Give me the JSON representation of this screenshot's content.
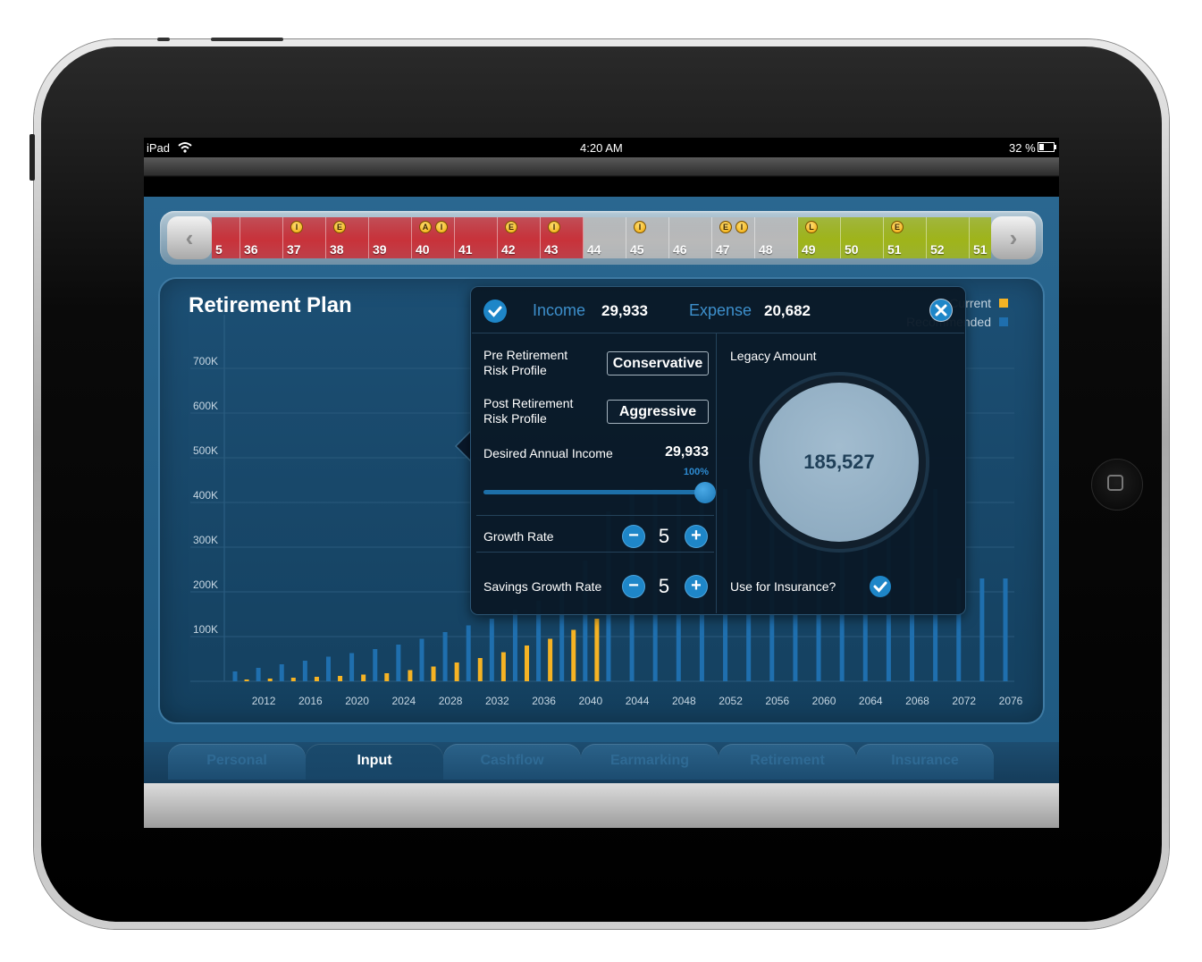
{
  "status_bar": {
    "device": "iPad",
    "time": "4:20 AM",
    "battery": "32 %"
  },
  "timeline": {
    "prev_icon": "chevron-left-icon",
    "next_icon": "chevron-right-icon",
    "cells": [
      {
        "age": "5",
        "color": "#c8323a",
        "badges": []
      },
      {
        "age": "36",
        "color": "#c8323a",
        "badges": []
      },
      {
        "age": "37",
        "color": "#c8323a",
        "badges": [
          "I"
        ]
      },
      {
        "age": "38",
        "color": "#c8323a",
        "badges": [
          "E"
        ]
      },
      {
        "age": "39",
        "color": "#c8323a",
        "badges": []
      },
      {
        "age": "40",
        "color": "#c8323a",
        "badges": [
          "A",
          "I"
        ]
      },
      {
        "age": "41",
        "color": "#c8323a",
        "badges": []
      },
      {
        "age": "42",
        "color": "#c8323a",
        "badges": [
          "E"
        ]
      },
      {
        "age": "43",
        "color": "#c8323a",
        "badges": [
          "I"
        ]
      },
      {
        "age": "44",
        "color": "#b9b9b9",
        "badges": []
      },
      {
        "age": "45",
        "color": "#b9b9b9",
        "badges": [
          "I"
        ]
      },
      {
        "age": "46",
        "color": "#b9b9b9",
        "badges": []
      },
      {
        "age": "47",
        "color": "#b9b9b9",
        "badges": [
          "E",
          "I"
        ]
      },
      {
        "age": "48",
        "color": "#b9b9b9",
        "badges": []
      },
      {
        "age": "49",
        "color": "#9fb41a",
        "badges": [
          "L"
        ]
      },
      {
        "age": "50",
        "color": "#9fb41a",
        "badges": []
      },
      {
        "age": "51",
        "color": "#9fb41a",
        "badges": [
          "E"
        ]
      },
      {
        "age": "52",
        "color": "#9fb41a",
        "badges": []
      },
      {
        "age": "51",
        "color": "#9fb41a",
        "badges": []
      }
    ]
  },
  "chart": {
    "title": "Retirement Plan",
    "legend": {
      "current": "Current",
      "recommended": "Recommended",
      "current_color": "#f5b324",
      "recommended_color": "#1f6fae"
    }
  },
  "chart_data": {
    "type": "bar",
    "title": "Retirement Plan",
    "y_ticks": [
      "700K",
      "600K",
      "500K",
      "400K",
      "300K",
      "200K",
      "100K"
    ],
    "x_ticks": [
      "2012",
      "2016",
      "2020",
      "2024",
      "2028",
      "2032",
      "2036",
      "2040",
      "2044",
      "2048",
      "2052",
      "2056",
      "2060",
      "2064",
      "2068",
      "2072",
      "2076"
    ],
    "ylim": [
      0,
      800000
    ],
    "series": [
      {
        "name": "Recommended",
        "color": "#1f6fae",
        "x": [
          2010,
          2012,
          2014,
          2016,
          2018,
          2020,
          2022,
          2024,
          2026,
          2028,
          2030,
          2032,
          2034,
          2036,
          2038,
          2040,
          2042,
          2044,
          2046,
          2048,
          2050,
          2052,
          2054,
          2056,
          2058,
          2060,
          2062,
          2064,
          2066,
          2068,
          2070,
          2072,
          2074,
          2076
        ],
        "values": [
          22000,
          30000,
          38000,
          46000,
          55000,
          63000,
          72000,
          82000,
          95000,
          110000,
          125000,
          140000,
          160000,
          180000,
          220000,
          270000,
          380000,
          430000,
          430000,
          430000,
          430000,
          430000,
          430000,
          430000,
          430000,
          430000,
          430000,
          430000,
          430000,
          430000,
          430000,
          230000,
          230000,
          230000
        ]
      },
      {
        "name": "Current",
        "color": "#f5b324",
        "x": [
          2011,
          2013,
          2015,
          2017,
          2019,
          2021,
          2023,
          2025,
          2027,
          2029,
          2031,
          2033,
          2035,
          2037,
          2039,
          2041
        ],
        "values": [
          4000,
          6000,
          8000,
          10000,
          12000,
          15000,
          18000,
          25000,
          33000,
          42000,
          52000,
          65000,
          80000,
          95000,
          115000,
          140000
        ]
      }
    ]
  },
  "popover": {
    "income_label": "Income",
    "income_value": "29,933",
    "expense_label": "Expense",
    "expense_value": "20,682",
    "pre_retirement_label_1": "Pre Retirement",
    "pre_retirement_label_2": "Risk Profile",
    "pre_retirement_value": "Conservative",
    "post_retirement_label_1": "Post Retirement",
    "post_retirement_label_2": "Risk Profile",
    "post_retirement_value": "Aggressive",
    "desired_income_label": "Desired Annual Income",
    "desired_income_value": "29,933",
    "desired_income_percent": "100%",
    "desired_income_slider": 1.0,
    "growth_rate_label": "Growth Rate",
    "growth_rate_value": "5",
    "savings_growth_label": "Savings Growth Rate",
    "savings_growth_value": "5",
    "legacy_label": "Legacy Amount",
    "legacy_value": "185,527",
    "insurance_label": "Use for Insurance?",
    "insurance_checked": true,
    "minus": "−",
    "plus": "+"
  },
  "tabs": [
    {
      "label": "Personal",
      "active": false
    },
    {
      "label": "Input",
      "active": true
    },
    {
      "label": "Cashflow",
      "active": false
    },
    {
      "label": "Earmarking",
      "active": false
    },
    {
      "label": "Retirement",
      "active": false
    },
    {
      "label": "Insurance",
      "active": false
    }
  ]
}
